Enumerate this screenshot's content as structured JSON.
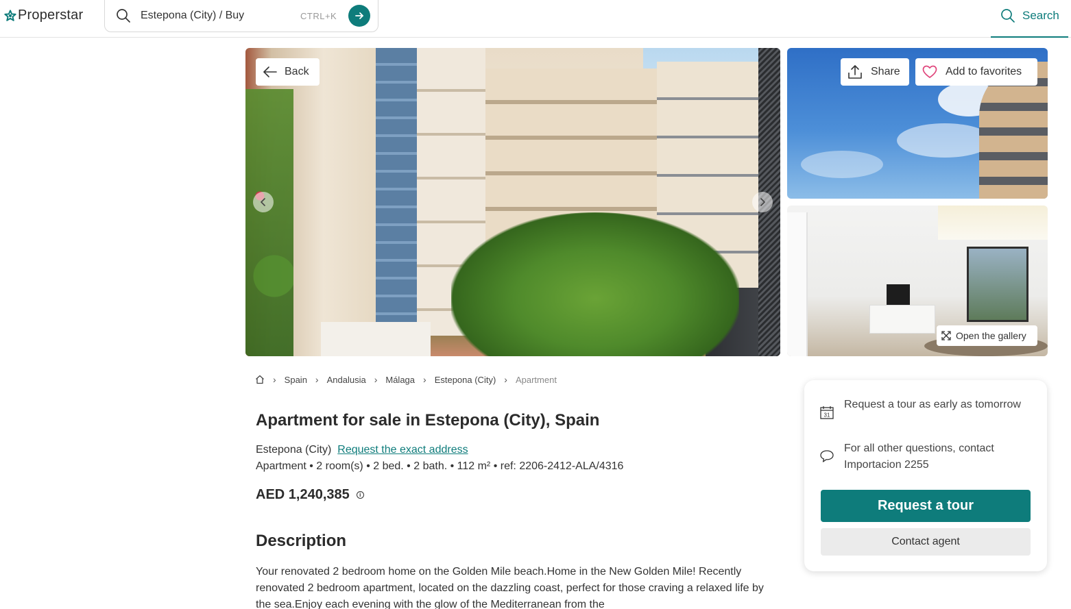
{
  "header": {
    "brand": "Properstar",
    "search_value": "Estepona (City) / Buy",
    "shortcut": "CTRL+K",
    "search_label": "Search"
  },
  "gallery": {
    "back_label": "Back",
    "share_label": "Share",
    "favorites_label": "Add to favorites",
    "open_gallery_label": "Open the gallery"
  },
  "breadcrumb": {
    "items": [
      "Spain",
      "Andalusia",
      "Málaga",
      "Estepona (City)",
      "Apartment"
    ]
  },
  "listing": {
    "title": "Apartment for sale in Estepona (City), Spain",
    "location": "Estepona (City)",
    "exact_address_link": "Request the exact address",
    "specs": "Apartment • 2 room(s) • 2 bed. • 2 bath. • 112 m² • ref: 2206-2412-ALA/4316",
    "price": "AED 1,240,385",
    "description_heading": "Description",
    "description": "Your renovated 2 bedroom home on the Golden Mile beach.Home in the New Golden Mile! Recently renovated 2 bedroom apartment, located on the dazzling coast, perfect for those craving a relaxed life by the sea.Enjoy each evening with the glow of the Mediterranean from the"
  },
  "contact_card": {
    "calendar_day": "31",
    "tour_info": "Request a tour as early as tomorrow",
    "contact_info": "For all other questions, contact Importacion 2255",
    "request_tour_label": "Request a tour",
    "contact_agent_label": "Contact agent"
  },
  "colors": {
    "accent": "#0e7c7b",
    "favorite_heart": "#e0457b"
  }
}
